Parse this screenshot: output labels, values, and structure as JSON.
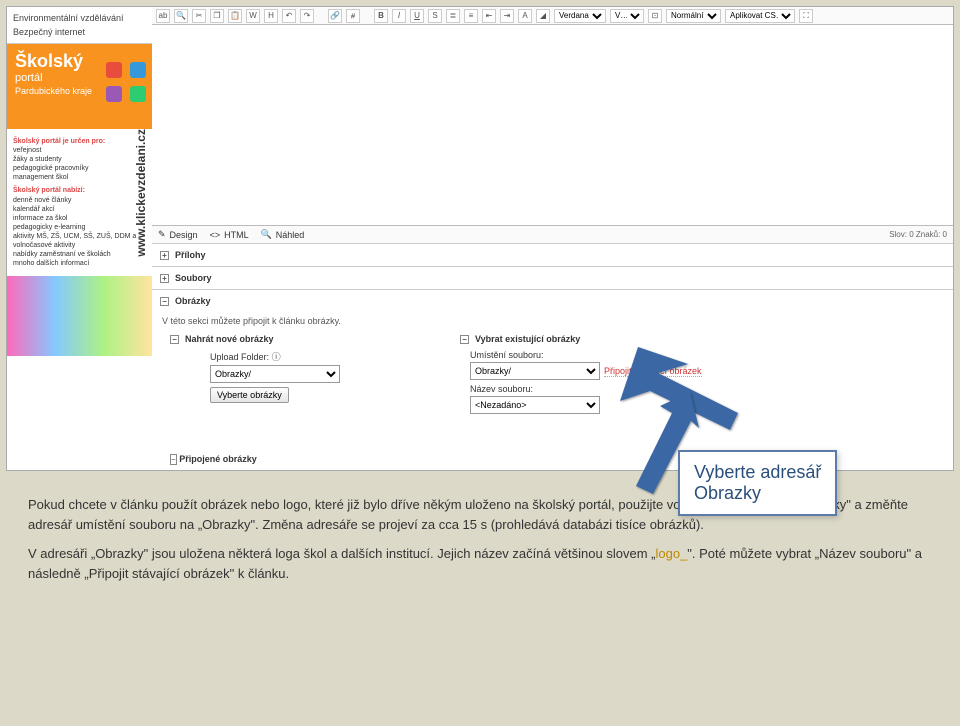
{
  "sidebar": {
    "links": [
      "Environmentální vzdělávání",
      "Bezpečný internet"
    ],
    "banner_title": "Školský",
    "banner_sub1": "portál",
    "banner_sub2": "Pardubického kraje",
    "vertical_url": "www.klickevzdelani.cz",
    "heading1": "Školský portál je určen pro:",
    "list1": [
      "veřejnost",
      "žáky a studenty",
      "pedagogické pracovníky",
      "management škol"
    ],
    "heading2": "Školský portál nabízí:",
    "list2": [
      "denně nové články",
      "kalendář akcí",
      "informace za škol",
      "pedagogicky e-learning",
      "aktivity MŠ, ZŠ, UCM, SŠ, ZUŠ, DDM a volnočasové aktivity",
      "nabídky zaměstnaní ve školách",
      "mnoho dalších informací"
    ]
  },
  "toolbar": {
    "font_family": "Verdana",
    "size": "V…",
    "style_label": "Normální",
    "apply_css": "Aplikovat CS…"
  },
  "tabs": {
    "design": "Design",
    "html": "HTML",
    "preview": "Náhled",
    "stats": "Slov: 0  Znaků: 0"
  },
  "sections": {
    "attachments": "Přílohy",
    "files": "Soubory",
    "images": "Obrázky"
  },
  "images": {
    "help": "V této sekci můžete připojit k článku obrázky.",
    "upload_header": "Nahrát nové obrázky",
    "upload_folder_label": "Upload Folder:",
    "folder_value": "Obrazky/",
    "select_button": "Vyberte obrázky",
    "existing_header": "Vybrat existující obrázky",
    "location_label": "Umístění souboru:",
    "location_value": "Obrazky/",
    "filename_label": "Název souboru:",
    "filename_value": "<Nezadáno>",
    "attach_link": "Připojit stávající obrázek",
    "attached_header": "Připojené obrázky"
  },
  "callout": {
    "line1": "Vyberte adresář",
    "line2": "Obrazky"
  },
  "explain": {
    "p1a": "Pokud chcete v článku použít obrázek nebo logo, které již bylo  dříve někým uloženo na školský portál, použijte volbu „Vybrat existující obrázky\" a změňte adresář umístění souboru na „Obrazky\". Změna adresáře se projeví za cca 15 s (prohledává databázi tisíce obrázků).",
    "p2a": "V adresáři „Obrazky\" jsou uložena některá loga škol a dalších institucí. Jejich název začíná většinou slovem „",
    "p2hl": "logo_",
    "p2b": "\". Poté můžete vybrat „Název souboru\" a následně „Připojit stávající obrázek\" k článku."
  }
}
